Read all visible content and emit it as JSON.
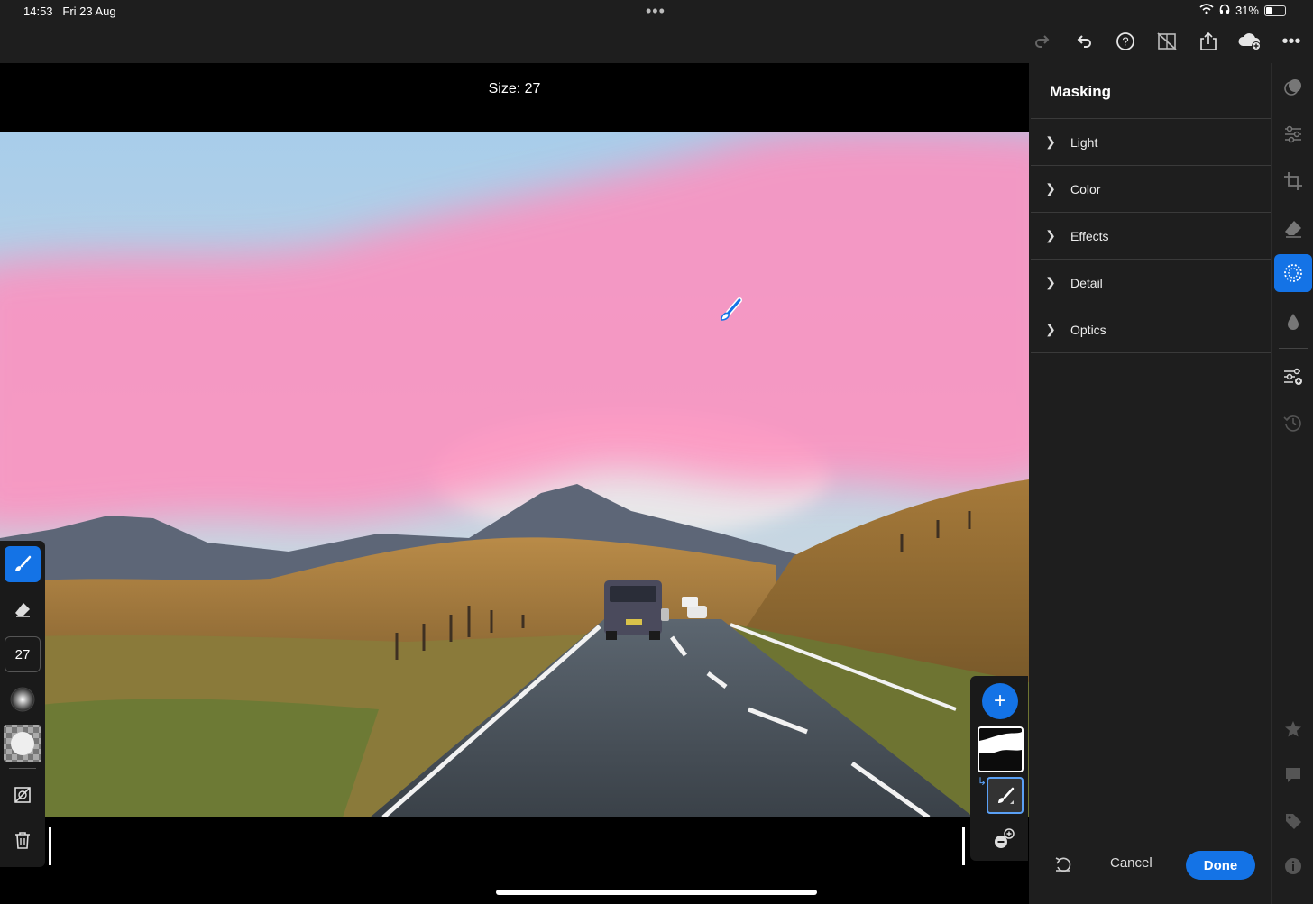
{
  "status": {
    "time": "14:53",
    "date": "Fri 23 Aug",
    "battery": "31%",
    "battery_level": 0.31,
    "dots": "•••"
  },
  "toolbar": {
    "icons": [
      "redo-icon",
      "undo-icon",
      "help-icon",
      "compare-off-icon",
      "share-icon",
      "cloud-add-icon",
      "more-icon"
    ],
    "more": "•••"
  },
  "canvas": {
    "size_label": "Size: 27"
  },
  "tools": {
    "size_value": "27"
  },
  "mask": {
    "add_label": "+"
  },
  "panel": {
    "title": "Masking",
    "sections": [
      {
        "label": "Light"
      },
      {
        "label": "Color"
      },
      {
        "label": "Effects"
      },
      {
        "label": "Detail"
      },
      {
        "label": "Optics"
      }
    ],
    "cancel_label": "Cancel",
    "done_label": "Done"
  },
  "colors": {
    "accent": "#1473e6",
    "mask_overlay": "#ff8fbe",
    "panel_bg": "#1e1e1e"
  }
}
